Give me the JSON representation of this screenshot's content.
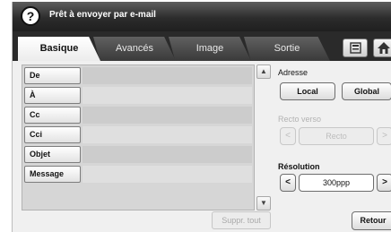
{
  "header": {
    "help_icon": "?",
    "title": "Prêt à envoyer par e-mail"
  },
  "tabs": [
    {
      "label": "Basique",
      "active": true
    },
    {
      "label": "Avancés",
      "active": false
    },
    {
      "label": "Image",
      "active": false
    },
    {
      "label": "Sortie",
      "active": false
    }
  ],
  "toolbar_icons": [
    "address-book-icon",
    "home-icon"
  ],
  "fields": [
    {
      "label": "De",
      "value": ""
    },
    {
      "label": "À",
      "value": ""
    },
    {
      "label": "Cc",
      "value": ""
    },
    {
      "label": "Cci",
      "value": ""
    },
    {
      "label": "Objet",
      "value": ""
    },
    {
      "label": "Message",
      "value": ""
    }
  ],
  "scroll": {
    "up": "▲",
    "down": "▼"
  },
  "actions": {
    "clear_all": "Suppr. tout",
    "back": "Retour"
  },
  "panel": {
    "address_label": "Adresse",
    "address_local": "Local",
    "address_global": "Global",
    "duplex_label": "Recto verso",
    "duplex_value": "Recto",
    "resolution_label": "Résolution",
    "resolution_value": "300ppp",
    "arrow_left": "<",
    "arrow_right": ">"
  },
  "colors": {
    "title_bar": "#2c2c2c",
    "tab_active": "#ffffff",
    "field_band_dark": "#cccccc",
    "field_band_light": "#dfdfdf"
  }
}
